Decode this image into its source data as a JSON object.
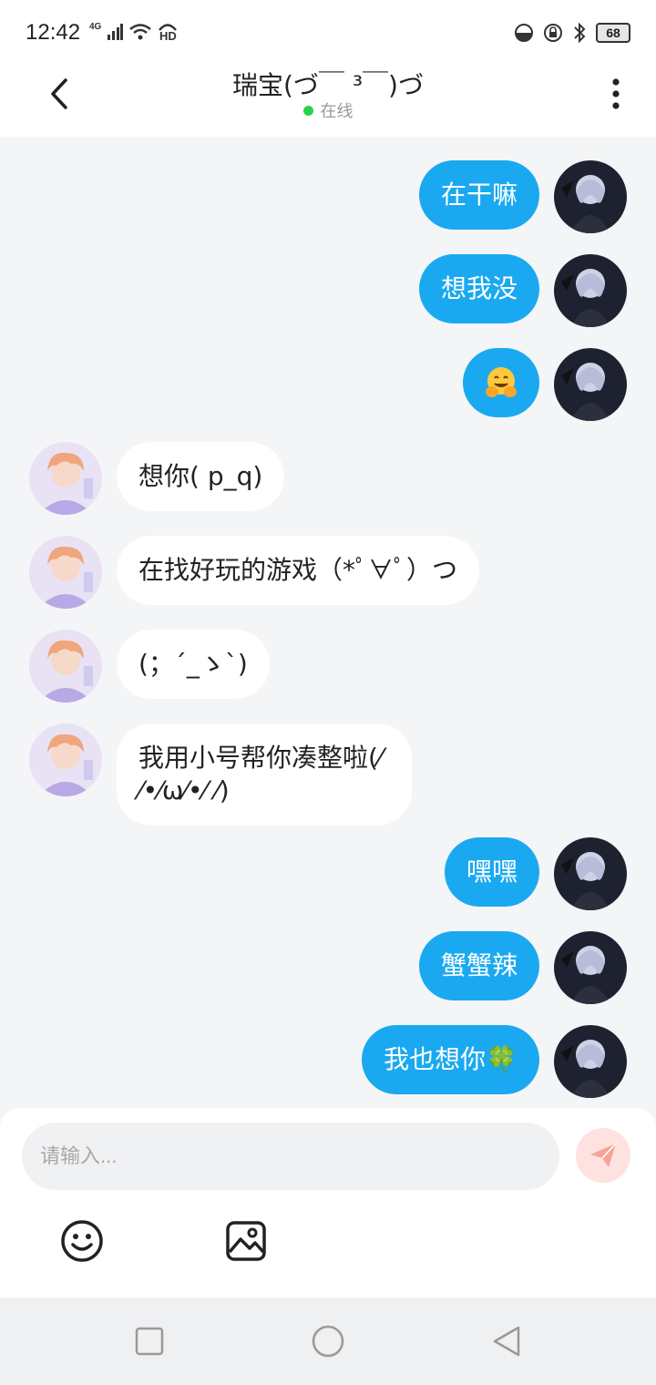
{
  "status_bar": {
    "time": "12:42",
    "network": "4G",
    "hd": "HD",
    "battery": "68"
  },
  "header": {
    "title": "瑞宝(づ￣ ³￣)づ",
    "status": "在线",
    "status_color": "#2bd14a"
  },
  "messages": [
    {
      "side": "right",
      "text": "在干嘛"
    },
    {
      "side": "right",
      "text": "想我没"
    },
    {
      "side": "right",
      "text": "",
      "emoji": "hugging-face"
    },
    {
      "side": "left",
      "text": "想你( p_q)"
    },
    {
      "side": "left",
      "text": "在找好玩的游戏（*ﾟ∀ﾟ）つ"
    },
    {
      "side": "left",
      "text": "(；´_ゝ`)"
    },
    {
      "side": "left",
      "text": "我用小号帮你凑整啦(⁄ ⁄•⁄ω⁄•⁄ ⁄)"
    },
    {
      "side": "right",
      "text": "嘿嘿"
    },
    {
      "side": "right",
      "text": "蟹蟹辣"
    },
    {
      "side": "right",
      "text": "我也想你🍀"
    }
  ],
  "composer": {
    "placeholder": "请输入...",
    "send_icon": "paper-plane-icon",
    "emoji_icon": "smiley-icon",
    "image_icon": "image-icon"
  },
  "colors": {
    "bubble_self": "#1aa9f0",
    "bubble_other": "#ffffff",
    "background": "#f3f5f7"
  },
  "nav_bar": {
    "recents_icon": "square-icon",
    "home_icon": "circle-icon",
    "back_icon": "triangle-back-icon"
  }
}
